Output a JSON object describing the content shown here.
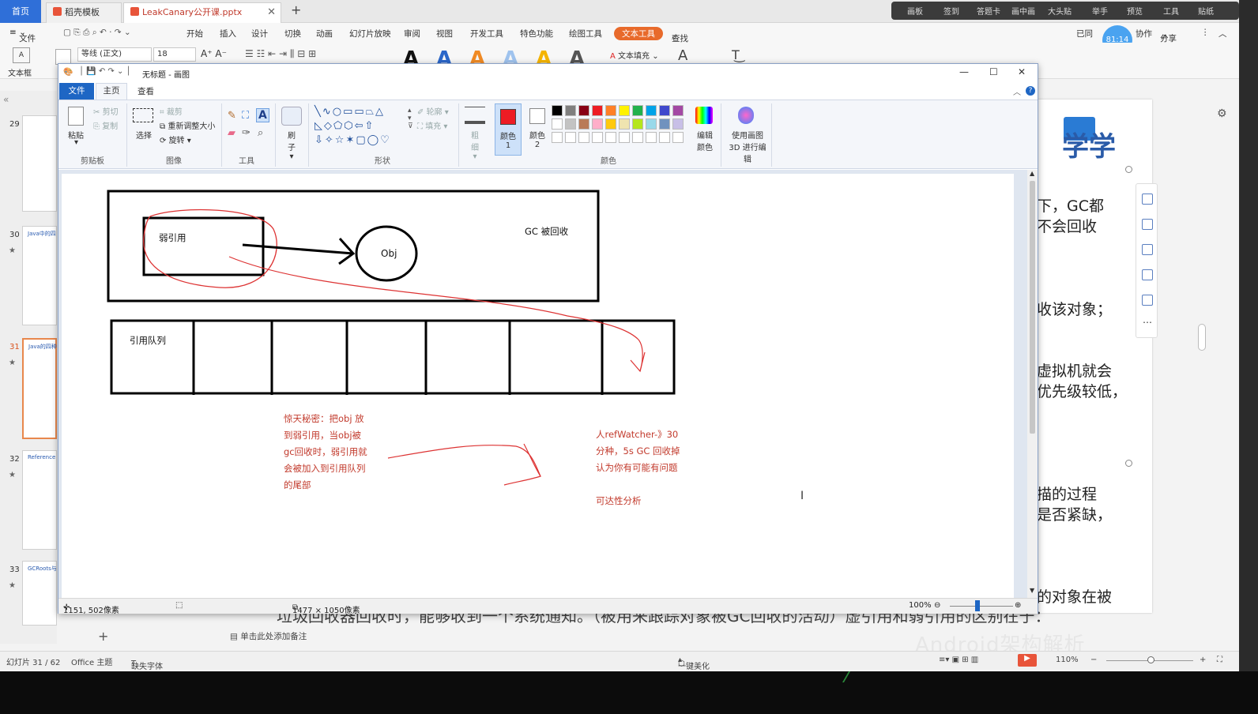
{
  "wps": {
    "tabs": {
      "home": "首页",
      "template": "稻壳模板",
      "doc": "LeakCanary公开课.pptx",
      "new_tab": "+"
    },
    "top_tools": [
      "画板",
      "签到",
      "答题卡",
      "画中画",
      "大头贴",
      "举手",
      "预览",
      "工具",
      "贴纸"
    ],
    "menu": [
      "文件",
      "开始",
      "插入",
      "设计",
      "切换",
      "动画",
      "幻灯片放映",
      "审阅",
      "视图",
      "开发工具",
      "特色功能",
      "绘图工具",
      "文本工具",
      "查找"
    ],
    "menu_active": "文本工具",
    "menu_right": [
      "已同",
      "协作",
      "分享"
    ],
    "avatar_time": "81:14",
    "font_name": "等线 (正文)",
    "font_size": "18",
    "text_box_label": "文本框",
    "text_fill_label": "文本填充",
    "slide_numbers": [
      "29",
      "30",
      "31",
      "32",
      "33"
    ],
    "current_slide": "31",
    "thumb_titles": {
      "s30": "Java中的四",
      "s31": "Java的四种",
      "s32": "Reference",
      "s33": "GCRoots与"
    },
    "slide_logo": "学学",
    "slide_lines": [
      "下，GC都",
      "不会回收",
      "收该对象；",
      "虚拟机就会",
      "优先级较低，",
      "描的过程",
      "是否紧缺，",
      "的对象在被"
    ],
    "bottom_text": "垃圾回收器回收时，能够收到一个系统通知。（被用来跟踪对象被GC回收的活动）虚引用和弱引用的区别在于：",
    "notes_placeholder": "单击此处添加备注",
    "status": {
      "slide": "幻灯片 31 / 62",
      "theme": "Office 主题",
      "font_missing": "缺失字体",
      "beautify": "一键美化",
      "zoom": "110%"
    },
    "watermark": "Android架构解析"
  },
  "paint": {
    "title": "无标题 - 画图",
    "tabs": {
      "file": "文件",
      "home": "主页",
      "view": "查看"
    },
    "clipboard": {
      "paste": "粘贴",
      "cut": "剪切",
      "copy": "复制",
      "group": "剪贴板"
    },
    "image": {
      "select": "选择",
      "crop": "裁剪",
      "resize": "重新调整大小",
      "rotate": "旋转",
      "group": "图像"
    },
    "tools_group": "工具",
    "brush": "刷子",
    "shapes": {
      "outline": "轮廓",
      "fill": "填充",
      "group": "形状"
    },
    "size": "粗细",
    "color1": "颜色 1",
    "color2": "颜色 2",
    "edit_colors": "编辑颜色",
    "paint3d": "使用画图 3D 进行编辑",
    "colors_group": "颜色",
    "palette": [
      "#000000",
      "#7f7f7f",
      "#880015",
      "#ed1c24",
      "#ff7f27",
      "#fff200",
      "#22b14c",
      "#00a2e8",
      "#3f48cc",
      "#a349a4",
      "#ffffff",
      "#c3c3c3",
      "#b97a57",
      "#ffaec9",
      "#ffc90e",
      "#efe4b0",
      "#b5e61d",
      "#99d9ea",
      "#7092be",
      "#c8bfe7"
    ],
    "active_color": "#ed1c24",
    "status": {
      "cursor": "1151, 502像素",
      "size": "1477 × 1050像素",
      "zoom": "100%"
    }
  },
  "canvas": {
    "weak_ref": "弱引用",
    "obj": "Obj",
    "gc": "GC 被回收",
    "queue": "引用队列",
    "note_left": [
      "惊天秘密：把obj 放",
      "到弱引用，当obj被",
      "gc回收时，弱引用就",
      "会被加入到引用队列",
      "的尾部"
    ],
    "note_right": [
      "人refWatcher-》30",
      "分种，5s GC 回收掉",
      "认为你有可能有问题",
      "",
      "可达性分析"
    ]
  }
}
